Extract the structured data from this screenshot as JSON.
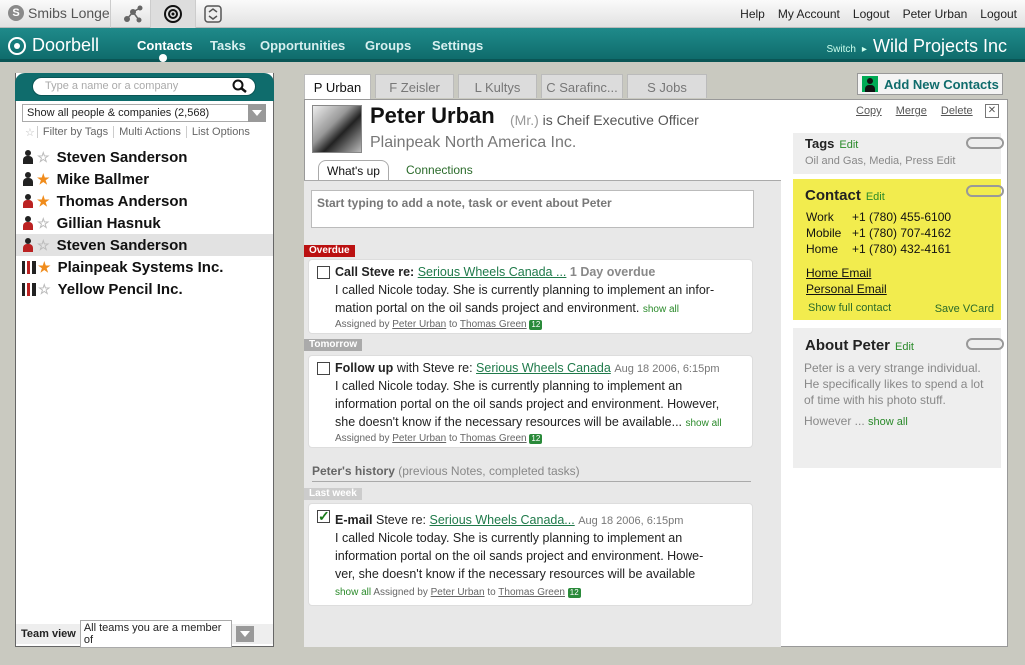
{
  "topbar": {
    "app_name": "Smibs Longe",
    "links": [
      "Help",
      "My Account",
      "Logout",
      "Peter Urban",
      "Logout"
    ]
  },
  "nav": {
    "brand": "Doorbell",
    "items": [
      "Contacts",
      "Tasks",
      "Opportunities",
      "Groups",
      "Settings"
    ],
    "switch_label": "Switch",
    "workspace": "Wild Projects Inc"
  },
  "left": {
    "search_placeholder": "Type a name or a company",
    "filter": "Show all people & companies (2,568)",
    "tag_actions": [
      "Filter by Tags",
      "Multi Actions",
      "List Options"
    ],
    "contacts": [
      {
        "name": "Steven Sanderson",
        "kind": "person",
        "starred": false
      },
      {
        "name": "Mike Ballmer",
        "kind": "person",
        "starred": true
      },
      {
        "name": "Thomas Anderson",
        "kind": "person-red",
        "starred": true
      },
      {
        "name": "Gillian Hasnuk",
        "kind": "person-red",
        "starred": false
      },
      {
        "name": "Steven Sanderson",
        "kind": "person-red",
        "starred": false
      },
      {
        "name": "Plainpeak Systems Inc.",
        "kind": "company",
        "starred": true
      },
      {
        "name": "Yellow Pencil Inc.",
        "kind": "company",
        "starred": false
      }
    ],
    "team_view_label": "Team view",
    "team_view_value": "All teams you are a member of"
  },
  "tabs": [
    "P Urban",
    "F Zeisler",
    "L Kultys",
    "C Sarafinc...",
    "S Jobs"
  ],
  "add_contacts": "Add New Contacts",
  "profile": {
    "name": "Peter Urban",
    "salutation": "(Mr.)",
    "title": "is Cheif Executive Officer",
    "company": "Plainpeak North America Inc.",
    "actions": [
      "Copy",
      "Merge",
      "Delete"
    ]
  },
  "subtabs": [
    "What's up",
    "Connections"
  ],
  "note_placeholder": "Start typing to add a note, task or event about Peter",
  "labels": {
    "overdue": "Overdue",
    "tomorrow": "Tomorrow",
    "last_week": "Last week"
  },
  "card1": {
    "title": "Call Steve re:",
    "link": "Serious Wheels Canada ...",
    "status": "1 Day overdue",
    "lines": [
      "I called Nicole today. She is currently planning to implement an infor-",
      "mation portal on the oil sands project and environment."
    ],
    "show_all": "show all",
    "assigned_by": "Assigned by",
    "assigner": "Peter Urban",
    "to": "to",
    "assignee": "Thomas Green",
    "bubble": "12"
  },
  "card2": {
    "title": "Follow up",
    "prefix": "with Steve re:",
    "link": "Serious Wheels Canada",
    "date": "Aug 18 2006, 6:15pm",
    "lines": [
      "I called Nicole today. She is currently planning to implement an",
      "information portal on the oil sands project and environment. However,",
      "she doesn't know if the necessary resources will be available..."
    ],
    "show_all": "show all",
    "assigned_by": "Assigned by",
    "assigner": "Peter Urban",
    "to": "to",
    "assignee": "Thomas Green",
    "bubble": "12"
  },
  "history": {
    "title": "Peter's history",
    "subtitle": "(previous Notes, completed tasks)"
  },
  "card3": {
    "title": "E-mail",
    "prefix": "Steve re:",
    "link": "Serious Wheels Canada...",
    "date": "Aug 18 2006, 6:15pm",
    "lines": [
      "I called Nicole today. She is currently planning to implement an",
      "information portal on the oil sands project and environment. Howe-",
      "ver, she doesn't know if the necessary resources will be available"
    ],
    "show_all": "show all",
    "assigned_by": "Assigned by",
    "assigner": "Peter Urban",
    "to": "to",
    "assignee": "Thomas Green",
    "bubble": "12"
  },
  "tags": {
    "title": "Tags",
    "edit": "Edit",
    "values": "Oil and Gas, Media, Press Edit"
  },
  "contact": {
    "title": "Contact",
    "edit": "Edit",
    "phones": [
      {
        "type": "Work",
        "number": "+1 (780) 455-6100"
      },
      {
        "type": "Mobile",
        "number": "+1 (780) 707-4162"
      },
      {
        "type": "Home",
        "number": "+1 (780) 432-4161"
      }
    ],
    "emails": [
      "Home Email",
      "Personal Email"
    ],
    "show_full": "Show full contact",
    "save_vcard": "Save VCard"
  },
  "about": {
    "title": "About Peter",
    "edit": "Edit",
    "text": "Peter is a very strange individual. He specifically likes to spend a lot of time with his photo stuff.",
    "however": "However ...",
    "show_all": "show all"
  },
  "colors": {
    "teal": "#0f6c6c",
    "overdue": "#b11111",
    "contact_bg": "#f2ec4e",
    "link_green": "#2a8a2a"
  }
}
